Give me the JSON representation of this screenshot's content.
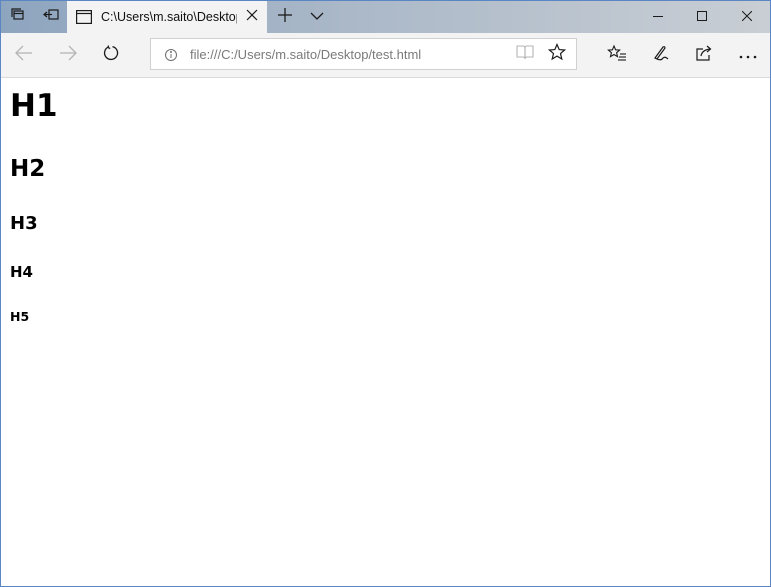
{
  "tab": {
    "title": "C:\\Users\\m.saito\\Desktop\\test.html"
  },
  "address_bar": {
    "url": "file:///C:/Users/m.saito/Desktop/test.html"
  },
  "icons": {
    "tab_sets": "tabs-aside-icon",
    "set_aside": "set-aside-icon",
    "page": "page-icon",
    "close_tab": "close-icon",
    "new_tab": "plus-icon",
    "tab_preview": "chevron-down-icon",
    "minimize": "minimize-icon",
    "maximize": "maximize-icon",
    "close_window": "close-icon",
    "back": "back-arrow-icon",
    "forward": "forward-arrow-icon",
    "refresh": "refresh-icon",
    "site_info": "info-icon",
    "reading_view": "book-icon",
    "favorite": "star-icon",
    "favorites_hub": "favorites-list-icon",
    "notes": "pen-icon",
    "share": "share-icon",
    "more": "more-icon"
  },
  "page": {
    "headings": {
      "h1": "H1",
      "h2": "H2",
      "h3": "H3",
      "h4": "H4",
      "h5": "H5"
    }
  },
  "colors": {
    "titlebar_start": "#8ea5bf",
    "titlebar_end": "#c9ced4",
    "toolbar": "#f3f3f3",
    "window_border": "#5b86c4"
  }
}
